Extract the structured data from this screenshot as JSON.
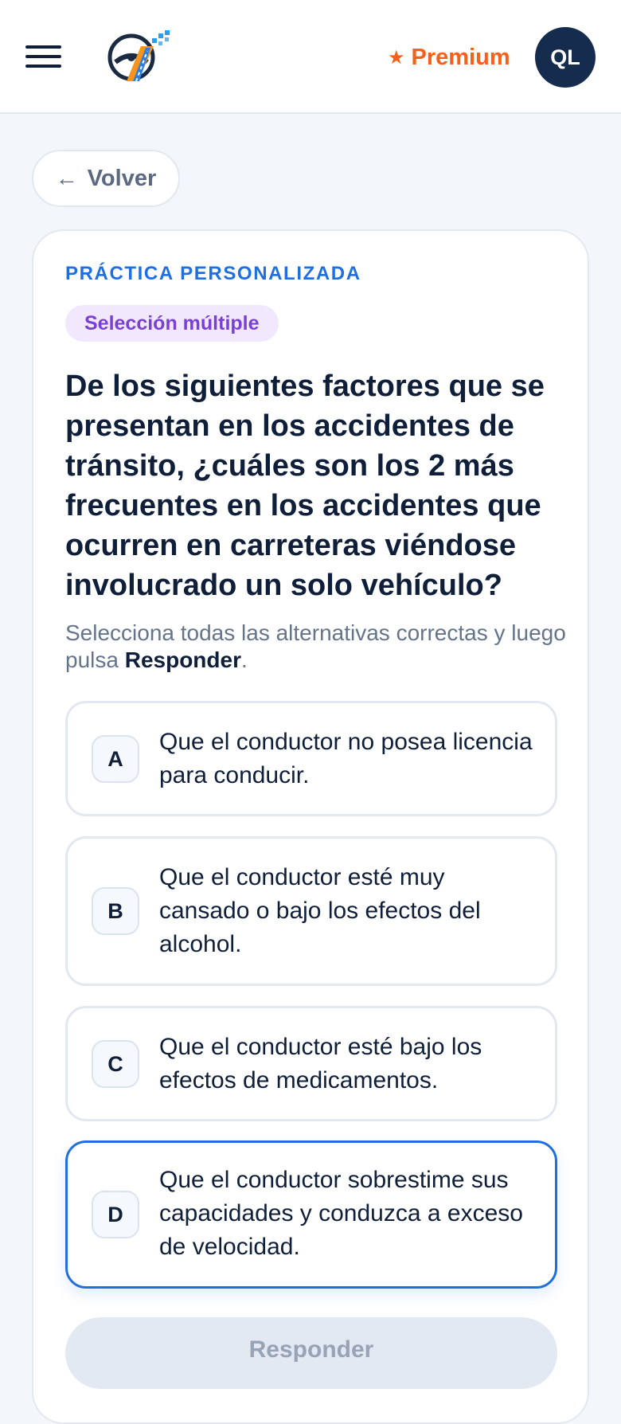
{
  "header": {
    "menu_icon": "hamburger-menu-icon",
    "logo_icon": "road-steering-wheel-logo",
    "premium_star": "★",
    "premium_label": "Premium",
    "avatar_initials": "QL",
    "colors": {
      "premium": "#f5601a",
      "avatar_bg": "#162c4f"
    }
  },
  "nav": {
    "back_arrow": "←",
    "back_label": "Volver"
  },
  "quiz": {
    "eyebrow": "PRÁCTICA PERSONALIZADA",
    "type_label": "Selección múltiple",
    "question": "De los siguientes factores que se presentan en los accidentes de tránsito, ¿cuáles son los 2 más frecuentes en los accidentes que ocurren en carreteras viéndose involucrado un solo vehículo?",
    "instructions_prefix": "Selecciona todas las alternativas correctas y luego pulsa ",
    "instructions_bold": "Responder",
    "instructions_suffix": ".",
    "options": [
      {
        "letter": "A",
        "text": "Que el conductor no posea licencia para conducir.",
        "selected": false
      },
      {
        "letter": "B",
        "text": "Que el conductor esté muy cansado o bajo los efectos del alcohol.",
        "selected": false
      },
      {
        "letter": "C",
        "text": "Que el conductor esté bajo los efectos de medicamentos.",
        "selected": false
      },
      {
        "letter": "D",
        "text": "Que el conductor sobrestime sus capacidades y conduzca a exceso de velocidad.",
        "selected": true
      }
    ],
    "submit_label": "Responder",
    "colors": {
      "accent": "#1f6fe0",
      "pill_bg": "#f1e8fd",
      "pill_text": "#7a3fd6"
    }
  }
}
